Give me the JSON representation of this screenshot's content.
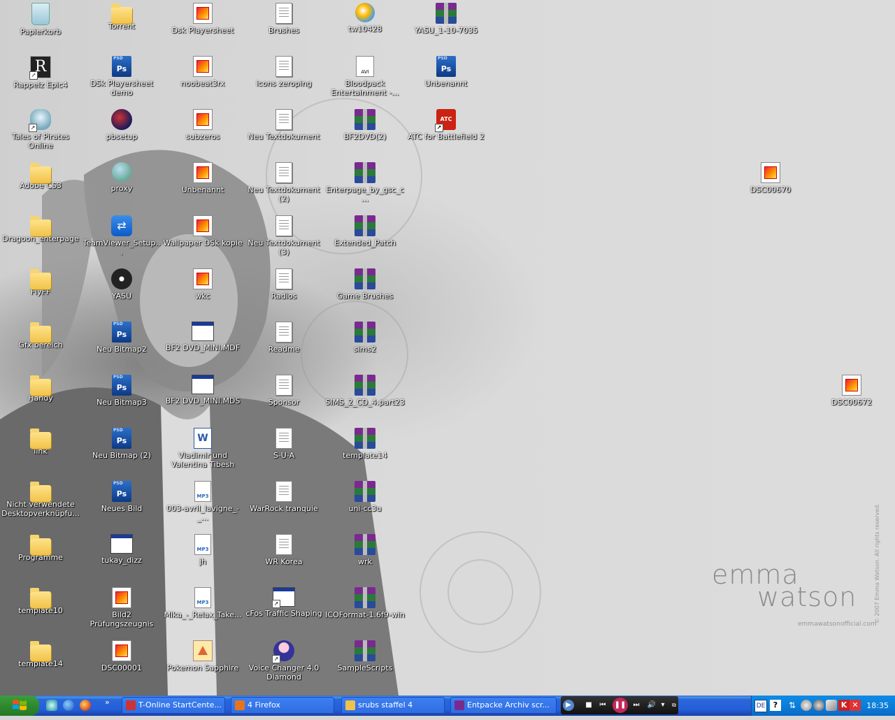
{
  "desktop": {
    "icons": [
      {
        "label": "Papierkorb",
        "type": "bin"
      },
      {
        "label": "Rappelz Epic4",
        "type": "r"
      },
      {
        "label": "Tales of Pirates Online",
        "type": "pir"
      },
      {
        "label": "Adobe CS3",
        "type": "folder"
      },
      {
        "label": "Dragoon_enterpage",
        "type": "folder"
      },
      {
        "label": "FlyFF",
        "type": "folder"
      },
      {
        "label": "Gfx bereich",
        "type": "folder"
      },
      {
        "label": "Handy",
        "type": "folder"
      },
      {
        "label": "link",
        "type": "folder"
      },
      {
        "label": "Nicht verwendete Desktopverknüpfu...",
        "type": "folder"
      },
      {
        "label": "Programme",
        "type": "folder"
      },
      {
        "label": "template10",
        "type": "folder"
      },
      {
        "label": "template14",
        "type": "folder"
      },
      {
        "label": "Torrent",
        "type": "folder"
      },
      {
        "label": "DSk Playersheet demo",
        "type": "ps"
      },
      {
        "label": "pbsetup",
        "type": "pbs"
      },
      {
        "label": "proxy",
        "type": "proxy"
      },
      {
        "label": "TeamViewer_Setup...",
        "type": "tv"
      },
      {
        "label": "YASU",
        "type": "disc"
      },
      {
        "label": "Neu Bitmap2",
        "type": "ps"
      },
      {
        "label": "Neu Bitmap3",
        "type": "ps"
      },
      {
        "label": "Neu Bitmap (2)",
        "type": "ps"
      },
      {
        "label": "Neues Bild",
        "type": "ps"
      },
      {
        "label": "tukay_dizz",
        "type": "app2"
      },
      {
        "label": "Bild2 Prüfungszeugnis",
        "type": "img"
      },
      {
        "label": "DSC00001",
        "type": "img"
      },
      {
        "label": "Dsk Playersheet",
        "type": "img"
      },
      {
        "label": "noobeat3rx",
        "type": "img"
      },
      {
        "label": "subzeros",
        "type": "img"
      },
      {
        "label": "Unbenannt",
        "type": "img"
      },
      {
        "label": "Wallpaper DSk kopie",
        "type": "img"
      },
      {
        "label": "wkc",
        "type": "img"
      },
      {
        "label": "BF2 DVD_MINI.MDF",
        "type": "app2"
      },
      {
        "label": "BF2 DVD_MINI.MDS",
        "type": "app2"
      },
      {
        "label": "Vladimir und Valentina Tibesh",
        "type": "word"
      },
      {
        "label": "003-avril_lavigne_-_...",
        "type": "mp3"
      },
      {
        "label": "jh",
        "type": "mp3"
      },
      {
        "label": "Mika_-_Relax_Take...",
        "type": "mp3"
      },
      {
        "label": "Pokemon Sapphire",
        "type": "poke"
      },
      {
        "label": "Brushes",
        "type": "doc"
      },
      {
        "label": "icons zeroping",
        "type": "doc"
      },
      {
        "label": "Neu Textdokument",
        "type": "doc"
      },
      {
        "label": "Neu Textdokument (2)",
        "type": "doc"
      },
      {
        "label": "Neu Textdokument (3)",
        "type": "doc"
      },
      {
        "label": "Radios",
        "type": "doc"
      },
      {
        "label": "Readme",
        "type": "doc"
      },
      {
        "label": "Sponsor",
        "type": "doc"
      },
      {
        "label": "S-U-A",
        "type": "doc"
      },
      {
        "label": "WarRock tranquie",
        "type": "doc"
      },
      {
        "label": "WR Korea",
        "type": "doc"
      },
      {
        "label": "cFos Traffic Shaping",
        "type": "app"
      },
      {
        "label": "Voice Changer 4.0 Diamond",
        "type": "voice"
      },
      {
        "label": "tw10428",
        "type": "dsk"
      },
      {
        "label": "Bloodpack Entertainment -...",
        "type": "avi"
      },
      {
        "label": "BF2DVD(2)",
        "type": "rar"
      },
      {
        "label": "Enterpage_by_gsc_c...",
        "type": "rar"
      },
      {
        "label": "Extended_Patch",
        "type": "rar"
      },
      {
        "label": "Game Brushes",
        "type": "rar"
      },
      {
        "label": "sims2",
        "type": "rar"
      },
      {
        "label": "SIMS_2_CD_4.part23",
        "type": "rar"
      },
      {
        "label": "template14",
        "type": "rar"
      },
      {
        "label": "uni-cc3u",
        "type": "rar"
      },
      {
        "label": "wrk",
        "type": "rar"
      },
      {
        "label": "ICOFormat-1.6f9-win",
        "type": "rar"
      },
      {
        "label": "SampleScripts",
        "type": "rar"
      },
      {
        "label": "YASU_1-10-7035",
        "type": "rar"
      },
      {
        "label": "Unbenannt",
        "type": "ps"
      },
      {
        "label": "ATC for Battlefield 2",
        "type": "atc"
      },
      {
        "label": "DSC00670",
        "type": "img"
      },
      {
        "label": "DSC00672",
        "type": "img"
      }
    ],
    "wallpaper": {
      "line1": "emma",
      "line2": "watson",
      "site": "emmawatsonofficial.com",
      "copyright": "© 2007 Emma Watson. All rights reserved."
    }
  },
  "taskbar": {
    "start_label": "",
    "quicklaunch_more": "»",
    "tasks": [
      {
        "label": "T-Online StartCente...",
        "icon": "ie-icon",
        "color": "#c33"
      },
      {
        "label": "4 Firefox",
        "icon": "firefox-icon",
        "color": "#e8741a"
      },
      {
        "label": "srubs staffel 4",
        "icon": "folder-icon",
        "color": "#f1c24a"
      },
      {
        "label": "Entpacke Archiv scr...",
        "icon": "winrar-icon",
        "color": "#7a2a8f"
      }
    ],
    "tray": {
      "language": "DE",
      "clock": "18:35"
    }
  },
  "colors": {
    "taskbar": "#245edb",
    "start": "#2f8a2f",
    "tray": "#0f8be6"
  }
}
